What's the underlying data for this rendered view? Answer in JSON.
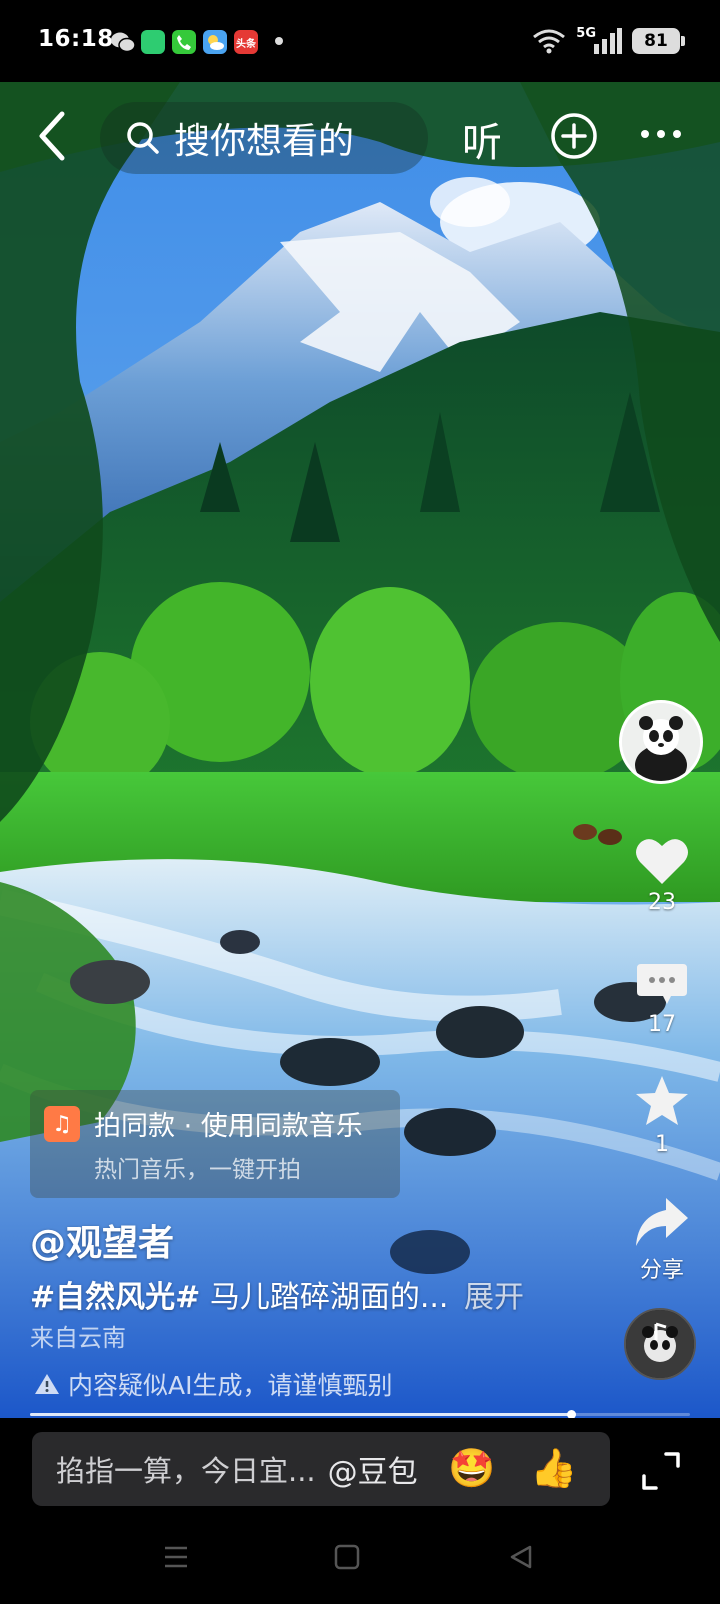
{
  "status_bar": {
    "time": "16:18",
    "network_label": "5G",
    "battery": "81",
    "notification_icons": [
      "wechat-icon",
      "messages-icon",
      "phone-icon",
      "weather-icon",
      "toutiao-icon"
    ],
    "notification_colors": [
      "#2ecc71",
      "#35c93a",
      "#3dbf55",
      "#4aa3f0",
      "#e53935"
    ],
    "toutiao_label": "头条"
  },
  "top_nav": {
    "search_placeholder": "搜你想看的",
    "listen_label": "听"
  },
  "right_rail": {
    "like_count": "23",
    "comment_count": "17",
    "favorite_count": "1",
    "share_label": "分享"
  },
  "same_style_card": {
    "title": "拍同款 · 使用同款音乐",
    "subtitle": "热门音乐，一键开拍"
  },
  "post": {
    "author": "@观望者",
    "hashtag": "#自然风光#",
    "description": "马儿踏碎湖面的...",
    "expand_label": "展开",
    "location": "来自云南",
    "ai_warning": "内容疑似AI生成，请谨慎甄别"
  },
  "playback": {
    "progress": 0.82
  },
  "comment_bar": {
    "placeholder": "掐指一算，今日宜...",
    "mention": "@豆包",
    "emoji_1": "🤩",
    "emoji_2": "👍"
  },
  "colors": {
    "accent_orange": "#ff7a45",
    "input_bg": "#2a2a2c"
  }
}
